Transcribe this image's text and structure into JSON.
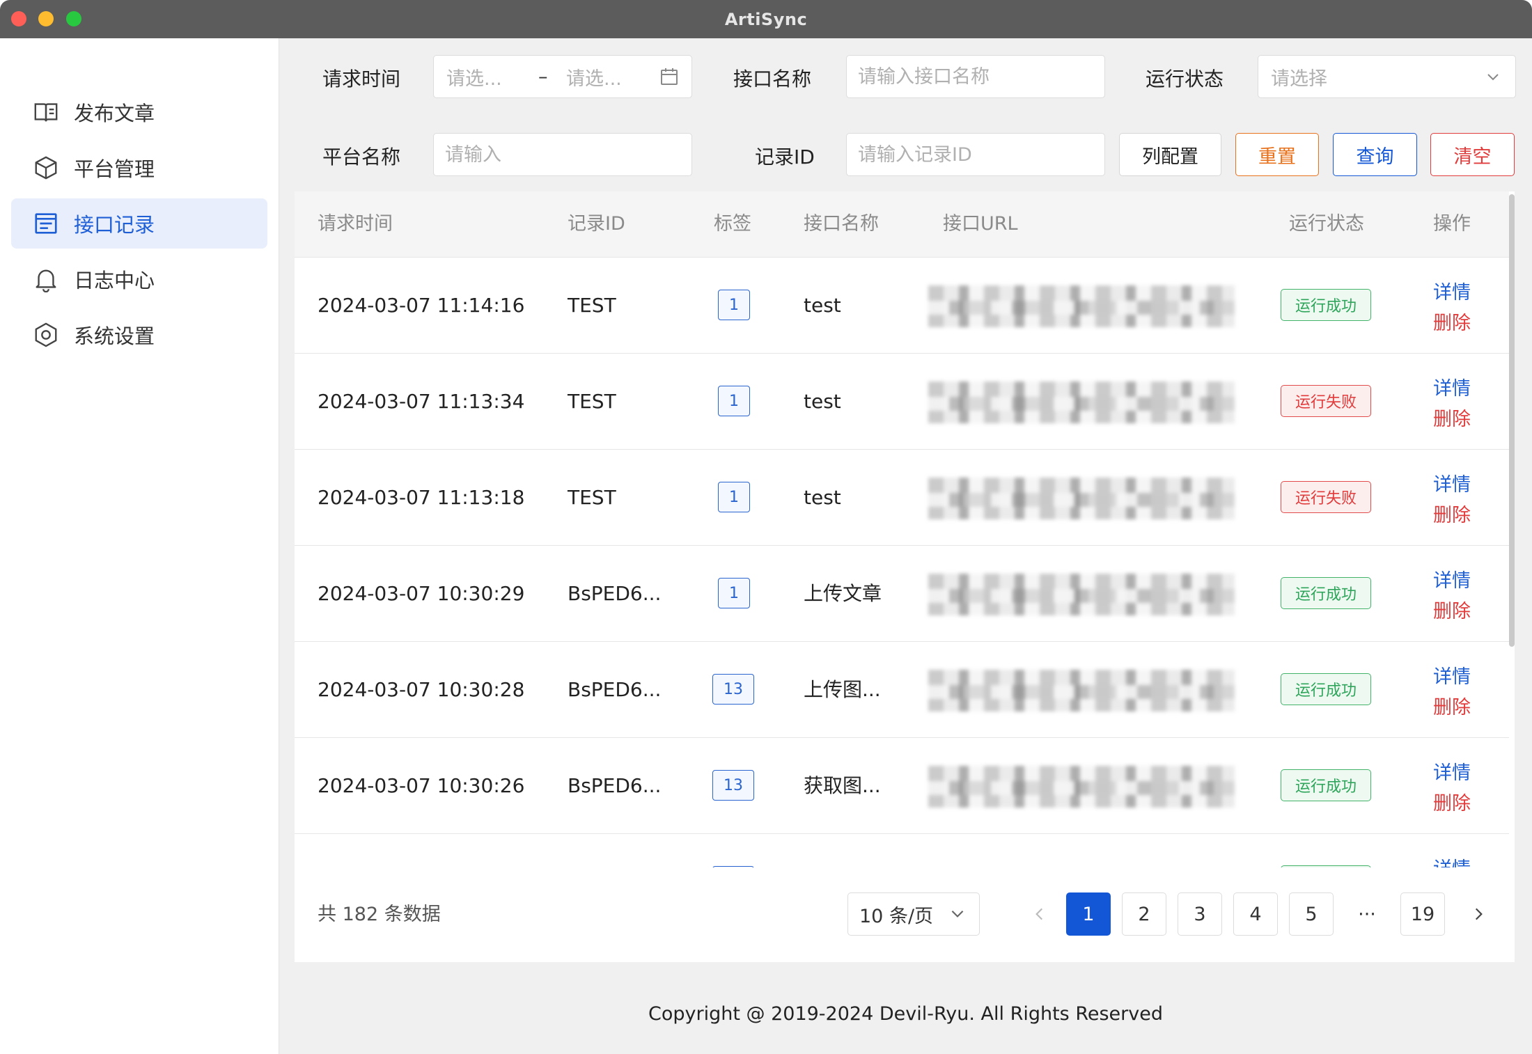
{
  "window": {
    "title": "ArtiSync"
  },
  "sidebar": {
    "items": [
      {
        "label": "发布文章",
        "icon": "book-icon",
        "active": false
      },
      {
        "label": "平台管理",
        "icon": "cube-icon",
        "active": false
      },
      {
        "label": "接口记录",
        "icon": "document-list-icon",
        "active": true
      },
      {
        "label": "日志中心",
        "icon": "bell-icon",
        "active": false
      },
      {
        "label": "系统设置",
        "icon": "gear-hexagon-icon",
        "active": false
      }
    ]
  },
  "filters": {
    "request_time_label": "请求时间",
    "date_start_placeholder": "请选...",
    "date_separator": "–",
    "date_end_placeholder": "请选...",
    "api_name_label": "接口名称",
    "api_name_placeholder": "请输入接口名称",
    "run_status_label": "运行状态",
    "run_status_placeholder": "请选择",
    "platform_name_label": "平台名称",
    "platform_name_placeholder": "请输入",
    "record_id_label": "记录ID",
    "record_id_placeholder": "请输入记录ID",
    "buttons": {
      "column_config": "列配置",
      "reset": "重置",
      "query": "查询",
      "clear": "清空"
    }
  },
  "table": {
    "columns": [
      "请求时间",
      "记录ID",
      "标签",
      "接口名称",
      "接口URL",
      "运行状态",
      "操作"
    ],
    "rows": [
      {
        "time": "2024-03-07 11:14:16",
        "record_id": "TEST",
        "tag": "1",
        "api_name": "test",
        "status": "运行成功",
        "status_type": "success",
        "detail": "详情",
        "delete": "删除"
      },
      {
        "time": "2024-03-07 11:13:34",
        "record_id": "TEST",
        "tag": "1",
        "api_name": "test",
        "status": "运行失败",
        "status_type": "fail",
        "detail": "详情",
        "delete": "删除"
      },
      {
        "time": "2024-03-07 11:13:18",
        "record_id": "TEST",
        "tag": "1",
        "api_name": "test",
        "status": "运行失败",
        "status_type": "fail",
        "detail": "详情",
        "delete": "删除"
      },
      {
        "time": "2024-03-07 10:30:29",
        "record_id": "BsPED6...",
        "tag": "1",
        "api_name": "上传文章",
        "status": "运行成功",
        "status_type": "success",
        "detail": "详情",
        "delete": "删除"
      },
      {
        "time": "2024-03-07 10:30:28",
        "record_id": "BsPED6...",
        "tag": "13",
        "api_name": "上传图...",
        "status": "运行成功",
        "status_type": "success",
        "detail": "详情",
        "delete": "删除"
      },
      {
        "time": "2024-03-07 10:30:26",
        "record_id": "BsPED6...",
        "tag": "13",
        "api_name": "获取图...",
        "status": "运行成功",
        "status_type": "success",
        "detail": "详情",
        "delete": "删除"
      },
      {
        "time": "",
        "record_id": "",
        "tag": "",
        "api_name": "",
        "status": "",
        "status_type": "success",
        "detail": "详情",
        "delete": ""
      }
    ]
  },
  "pagination": {
    "total_text": "共 182 条数据",
    "page_size": "10 条/页",
    "pages": [
      "1",
      "2",
      "3",
      "4",
      "5"
    ],
    "ellipsis": "···",
    "last_page": "19",
    "current_page": "1"
  },
  "footer": {
    "copyright": "Copyright @ 2019-2024 Devil-Ryu. All Rights Reserved"
  },
  "colors": {
    "primary": "#1357d6",
    "success": "#2ea55a",
    "danger": "#e13b3b",
    "reset_orange": "#e8711c",
    "active_nav_bg": "#e8eefc"
  }
}
